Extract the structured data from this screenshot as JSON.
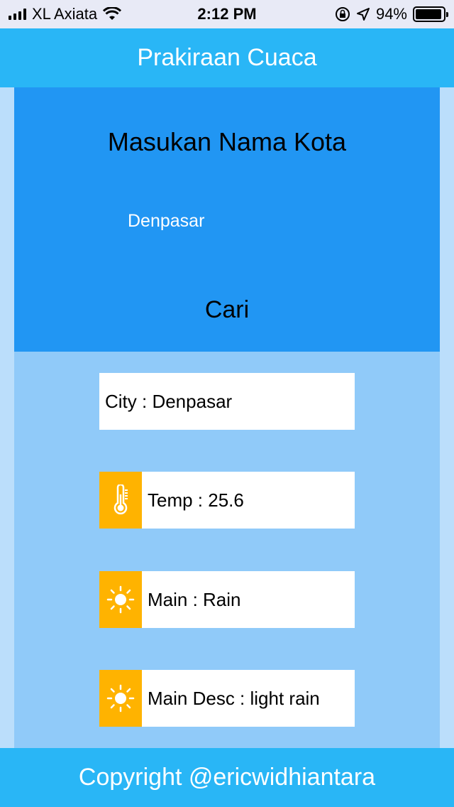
{
  "status_bar": {
    "carrier": "XL Axiata",
    "time": "2:12 PM",
    "battery": "94%",
    "battery_level": 0.94
  },
  "app_bar": {
    "title": "Prakiraan Cuaca"
  },
  "search": {
    "title": "Masukan Nama Kota",
    "input_value": "Denpasar",
    "button_label": "Cari"
  },
  "weather": {
    "city": "City : Denpasar",
    "temp": "Temp : 25.6",
    "main": "Main : Rain",
    "desc": "Main Desc : light rain"
  },
  "icons": {
    "temp": "thermometer-icon",
    "main": "sun-icon",
    "desc": "sun-icon"
  },
  "colors": {
    "app_bar": "#29b6f6",
    "panel": "#2196f3",
    "content_bg": "#90caf9",
    "icon_bg": "#ffb300"
  },
  "footer": {
    "text": "Copyright @ericwidhiantara"
  }
}
